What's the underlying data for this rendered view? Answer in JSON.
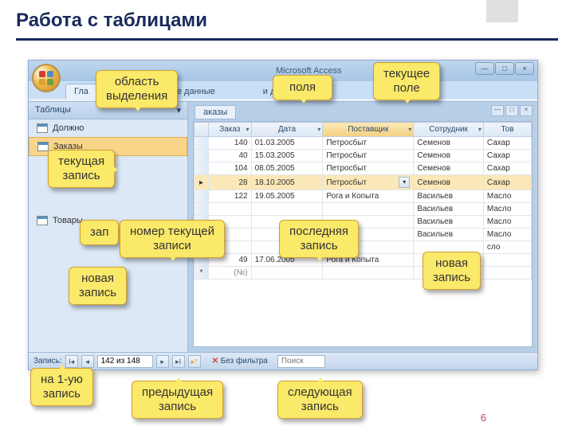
{
  "slide": {
    "title": "Работа с таблицами",
    "page_number": "6"
  },
  "app": {
    "title": "Microsoft Access",
    "ribbon_tabs": [
      "Гла",
      "е данные",
      "и данных"
    ],
    "nav_header": "Таблицы",
    "nav_items": [
      "Должно",
      "Заказы",
      "Товары"
    ],
    "doc_tab": "аказы"
  },
  "table": {
    "columns": [
      "Заказ",
      "Дата",
      "Поставщик",
      "Сотрудник",
      "Тов"
    ],
    "rows": [
      {
        "order": "140",
        "date": "01.03.2005",
        "supplier": "Петросбыт",
        "employee": "Семенов",
        "product": "Сахар"
      },
      {
        "order": "40",
        "date": "15.03.2005",
        "supplier": "Петросбыт",
        "employee": "Семенов",
        "product": "Сахар"
      },
      {
        "order": "104",
        "date": "08.05.2005",
        "supplier": "Петросбыт",
        "employee": "Семенов",
        "product": "Сахар"
      },
      {
        "order": "28",
        "date": "18.10.2005",
        "supplier": "Петросбыт",
        "employee": "Семенов",
        "product": "Сахар"
      },
      {
        "order": "122",
        "date": "19.05.2005",
        "supplier": "Рога и Копыта",
        "employee": "Васильев",
        "product": "Масло"
      },
      {
        "order": "",
        "date": "",
        "supplier": "",
        "employee": "Васильев",
        "product": "Масло"
      },
      {
        "order": "",
        "date": "",
        "supplier": "",
        "employee": "Васильев",
        "product": "Масло"
      },
      {
        "order": "",
        "date": "",
        "supplier": "",
        "employee": "Васильев",
        "product": "Масло"
      },
      {
        "order": "",
        "date": "",
        "supplier": "",
        "employee": "",
        "product": "сло"
      },
      {
        "order": "49",
        "date": "17.06.2005",
        "supplier": "Рога и Копыта",
        "employee": "",
        "product": ""
      }
    ],
    "new_row_marker": "*",
    "new_row_placeholder": "(№)"
  },
  "statusbar": {
    "label": "Запись:",
    "position": "142 из 148",
    "filter": "Без фильтра",
    "search": "Поиск"
  },
  "callouts": {
    "selection_area": "область\nвыделения",
    "fields": "поля",
    "current_field": "текущее\nполе",
    "current_record": "текущая\nзапись",
    "rec_partial": "зап",
    "current_record_number": "номер текущей\nзаписи",
    "last_record": "последняя\nзапись",
    "new_record_left": "новая\nзапись",
    "new_record_right": "новая\nзапись",
    "first_record": "на 1-ую\nзапись",
    "prev_record": "предыдущая\nзапись",
    "next_record": "следующая\nзапись"
  }
}
